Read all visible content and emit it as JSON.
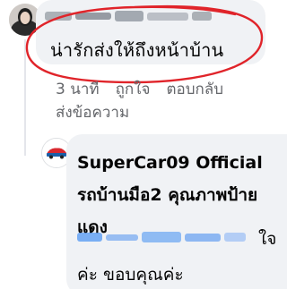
{
  "comment": {
    "text": "น่ารักส่งให้ถึงหน้าบ้าน",
    "time": "3 นาที",
    "like_label": "ถูกใจ",
    "reply_label": "ตอบกลับ",
    "send_message_label": "ส่งข้อความ"
  },
  "reply": {
    "author": "SuperCar09 Official รถบ้านมือ2 คุณภาพป้ายแดง",
    "text_tail": "ใจ",
    "text_line2": "ค่ะ ขอบคุณค่ะ"
  },
  "colors": {
    "bubble": "#f0f2f5",
    "secondary_text": "#65676b",
    "mention_blue": "#1877f2",
    "annotation_red": "#e0242a"
  }
}
